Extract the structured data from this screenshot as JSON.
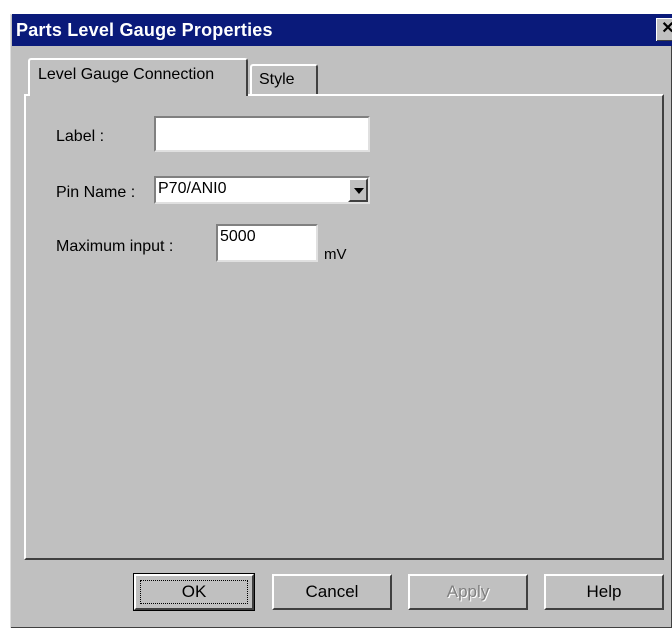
{
  "window": {
    "title": "Parts Level Gauge Properties",
    "close_glyph": "✕"
  },
  "tabs": [
    {
      "label": "Level Gauge Connection",
      "active": true
    },
    {
      "label": "Style",
      "active": false
    }
  ],
  "form": {
    "label_caption": "Label :",
    "label_value": "",
    "pin_caption": "Pin Name :",
    "pin_value": "P70/ANI0",
    "max_caption": "Maximum input :",
    "max_value": "5000",
    "max_unit": "mV"
  },
  "buttons": {
    "ok": "OK",
    "cancel": "Cancel",
    "apply": "Apply",
    "help": "Help"
  },
  "icons": {
    "close": "close-icon",
    "dropdown": "chevron-down-icon"
  },
  "colors": {
    "titlebar": "#0a1a7a",
    "dialog_face": "#c0c0c0"
  }
}
